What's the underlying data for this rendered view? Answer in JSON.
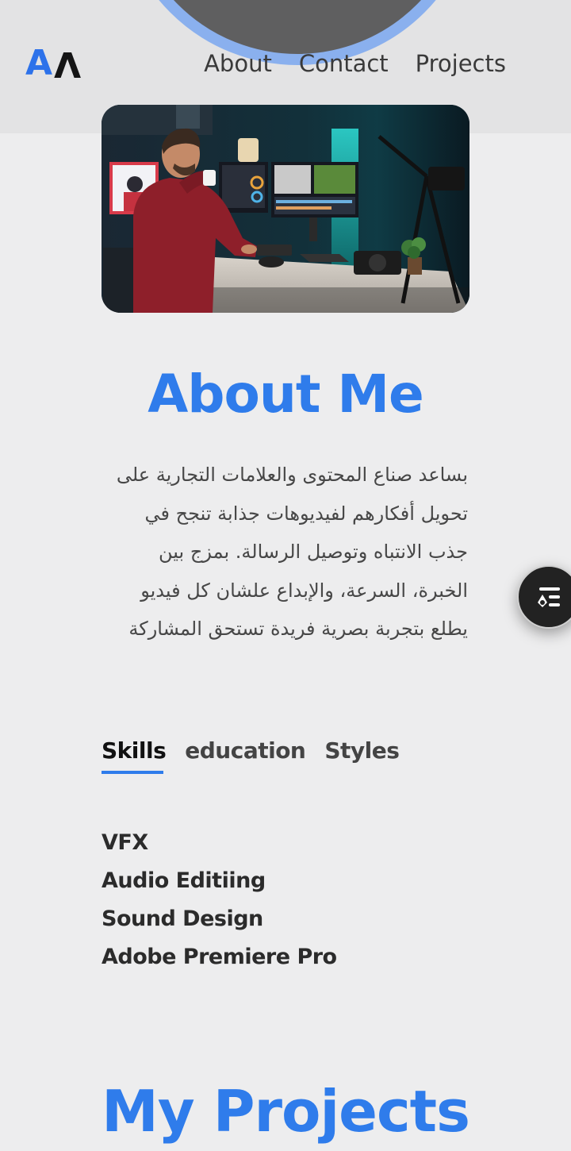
{
  "header": {
    "logo": {
      "first": "A",
      "second": "V"
    },
    "nav": [
      {
        "label": "About"
      },
      {
        "label": "Contact"
      },
      {
        "label": "Projects"
      }
    ]
  },
  "hero": {
    "image": "video-editor-at-desk-photo"
  },
  "about": {
    "title": "About Me",
    "description": "بساعد صناع المحتوى والعلامات التجارية على تحويل أفكارهم لفيديوهات جذابة تنجح في جذب الانتباه وتوصيل الرسالة. بمزج بين الخبرة، السرعة، والإبداع علشان كل فيديو يطلع بتجربة بصرية فريدة تستحق المشاركة"
  },
  "tabs": [
    {
      "label": "Skills",
      "active": true
    },
    {
      "label": "education",
      "active": false
    },
    {
      "label": "Styles",
      "active": false
    }
  ],
  "skills": [
    "VFX",
    "Audio Editiing",
    "Sound Design",
    "Adobe Premiere Pro"
  ],
  "projects": {
    "title": "My Projects"
  },
  "fab": {
    "icon": "menu-toggle-icon"
  },
  "colors": {
    "accent": "#2f7ceb",
    "background": "#ededee",
    "header_background": "#e3e3e4",
    "header_circle_ring": "#8ab0ee"
  }
}
